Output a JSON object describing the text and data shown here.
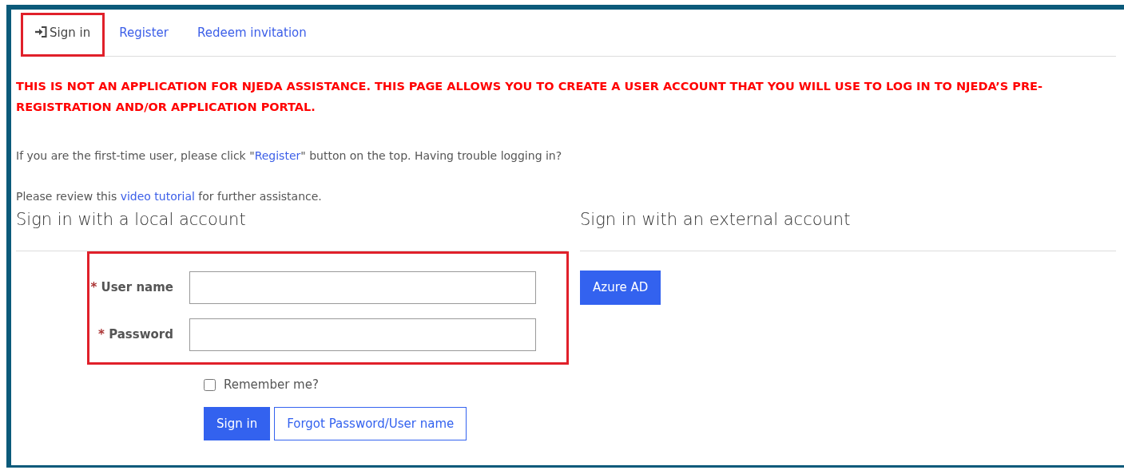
{
  "tabs": [
    {
      "label": "Sign in",
      "selected": true,
      "highlighted": true
    },
    {
      "label": "Register",
      "selected": false,
      "highlighted": false
    },
    {
      "label": "Redeem invitation",
      "selected": false,
      "highlighted": false
    }
  ],
  "notice": "THIS IS NOT AN APPLICATION FOR NJEDA ASSISTANCE. THIS PAGE ALLOWS YOU TO CREATE A USER ACCOUNT THAT YOU WILL USE TO LOG IN TO NJEDA’S PRE-REGISTRATION AND/OR APPLICATION PORTAL.",
  "intro": {
    "before": "If you are the first-time user, please click \"",
    "link": "Register",
    "after": "\" button on the top. Having trouble logging in?"
  },
  "help": {
    "before": "Please review this ",
    "link": "video tutorial",
    "after": " for further assistance."
  },
  "local": {
    "heading": "Sign in with a local account",
    "fields_highlighted": true,
    "fields": [
      {
        "label": "User name",
        "required_mark": "*"
      },
      {
        "label": "Password",
        "required_mark": "*"
      }
    ],
    "remember": {
      "label": "Remember me?",
      "checked": false
    },
    "buttons": [
      {
        "label": "Sign in",
        "kind": "primary"
      },
      {
        "label": "Forgot Password/User name",
        "kind": "outline"
      }
    ]
  },
  "external": {
    "heading": "Sign in with an external account",
    "providers": [
      {
        "label": "Azure AD"
      }
    ]
  }
}
